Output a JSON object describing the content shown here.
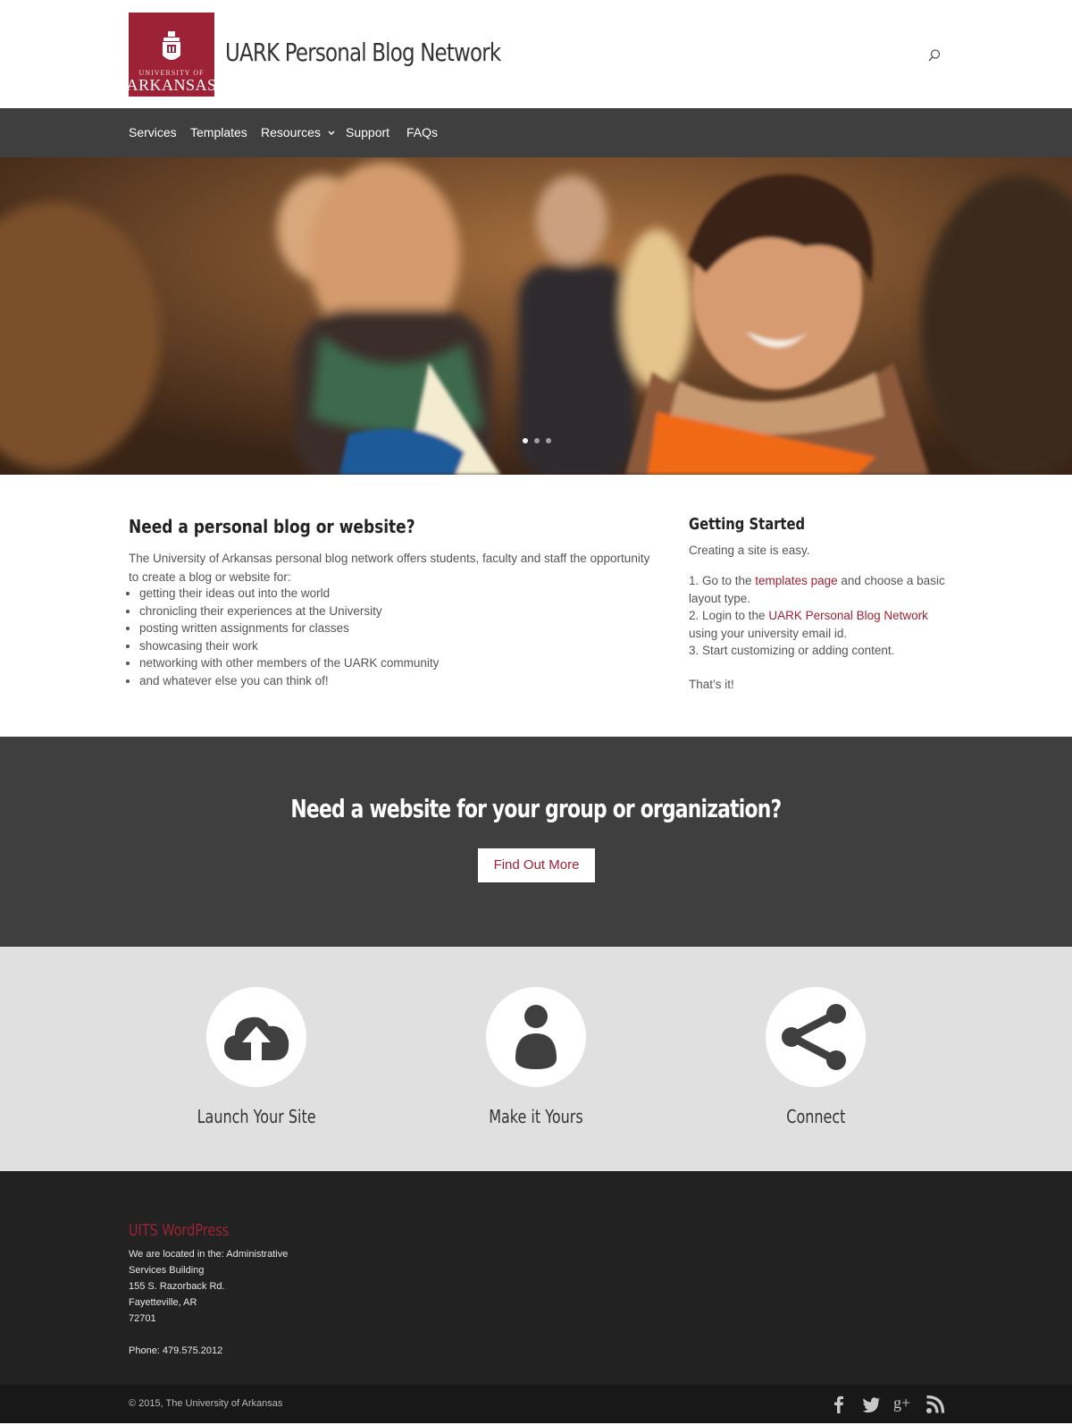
{
  "header": {
    "logo": {
      "line1": "UNIVERSITY OF",
      "line2": "ARKANSAS"
    },
    "site_title": "UARK Personal Blog Network",
    "search_icon": "search-icon"
  },
  "nav": {
    "items": [
      {
        "label": "Services"
      },
      {
        "label": "Templates"
      },
      {
        "label": "Resources",
        "has_dropdown": true
      },
      {
        "label": "Support"
      },
      {
        "label": "FAQs"
      }
    ]
  },
  "hero": {
    "slide_count": 3,
    "active_slide": 1
  },
  "intro": {
    "heading": "Need a personal blog or website?",
    "paragraph": "The University of Arkansas personal blog network offers students, faculty and staff the opportunity to create a blog or website for:",
    "list": [
      "getting their ideas out into the world",
      "chronicling their experiences at the University",
      "posting written assignments for classes",
      "showcasing their work",
      "networking with other members of the UARK community",
      "and whatever else you can think of!"
    ]
  },
  "getting_started": {
    "heading": "Getting Started",
    "intro": "Creating a site is easy.",
    "step1_prefix": "1. Go to the ",
    "step1_link": "templates page",
    "step1_suffix": " and choose a basic layout type.",
    "step2_prefix": "2. Login to the ",
    "step2_link": "UARK Personal Blog Network",
    "step2_suffix": " using your university email id.",
    "step3": "3. Start customizing or adding content.",
    "outro": "That’s it!"
  },
  "cta": {
    "heading": "Need a website for your group or organization?",
    "button": "Find Out More"
  },
  "features": [
    {
      "label": "Launch Your Site",
      "icon": "cloud-upload-icon"
    },
    {
      "label": "Make it Yours",
      "icon": "user-icon"
    },
    {
      "label": "Connect",
      "icon": "share-icon"
    }
  ],
  "footer": {
    "title": "UITS WordPress",
    "lines": [
      "We are located in the: Administrative",
      "Services Building",
      "155 S. Razorback Rd.",
      "Fayetteville, AR",
      "72701"
    ],
    "phone": "Phone: 479.575.2012",
    "copyright": "© 2015, The University of Arkansas",
    "social": [
      "facebook-icon",
      "twitter-icon",
      "google-plus-icon",
      "rss-icon"
    ]
  },
  "colors": {
    "accent": "#9d2235",
    "nav_bg": "#3f3f3f",
    "features_bg": "#e0e0e0",
    "footer_bg": "#222222"
  }
}
